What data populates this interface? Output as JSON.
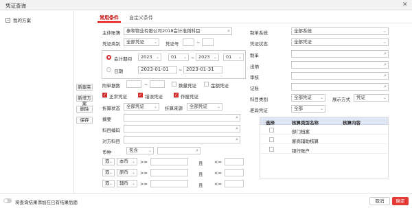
{
  "window": {
    "title": "凭证查询"
  },
  "tree": {
    "root": "我的方案"
  },
  "side_buttons": [
    "新建夹",
    "新增方案",
    "删除",
    "保存"
  ],
  "tabs": [
    {
      "label": "常用条件"
    },
    {
      "label": "自定义条件"
    }
  ],
  "form": {
    "main_book_label": "主体账簿",
    "main_book_value": "泰和物业有限公司2018会计准则科目",
    "voucher_type_label": "凭证类别",
    "voucher_type_value": "全部凭证",
    "voucher_no_label": "凭证号",
    "tilde": "~",
    "period_label": "会计期间",
    "date_label": "日期",
    "period_from_year": "2023",
    "period_from_month": "01",
    "period_to_year": "2023",
    "period_to_month": "01",
    "date_from": "2023-01-01",
    "date_to": "2023-01-31",
    "attach_label": "附单据数",
    "qty_label": "数量凭证",
    "amount_label": "金额凭证",
    "normal_label": "正常凭证",
    "error_label": "错误凭证",
    "void_label": "作废凭证",
    "fold_label": "折算状态",
    "fold_value": "全部凭证",
    "fold_source_label": "折算来源",
    "fold_source_value": "全部凭证",
    "abstract_label": "摘要",
    "subject_code_label": "科目编码",
    "counter_subject_label": "对方科目",
    "currency_label": "币种",
    "currency_value": "包含",
    "amount_rows": [
      {
        "dir": "双",
        "type": "本币",
        "ge": ">=",
        "and": "且",
        "le": "<="
      },
      {
        "dir": "双",
        "type": "原币",
        "ge": ">=",
        "and": "且",
        "le": "<="
      },
      {
        "dir": "双",
        "type": "辅币",
        "ge": ">=",
        "and": "且",
        "le": "<="
      }
    ]
  },
  "right_form": {
    "system_label": "制单系统",
    "system_value": "全部系统",
    "status_label": "凭证状态",
    "status_value": "全部凭证",
    "maker_label": "制单",
    "cashier_label": "出纳",
    "auditor_label": "审核",
    "bookkeeper_label": "记账",
    "subject_type_label": "科目类别",
    "subject_type_value": "全部凭证",
    "display_label": "展示方式",
    "display_value": "凭证",
    "diff_label": "差异凭证",
    "diff_value": "全部"
  },
  "table": {
    "headers": [
      "选择",
      "核算类型名称",
      "核算内容"
    ],
    "rows": [
      {
        "name": "部门档案"
      },
      {
        "name": "客商辅助核算"
      },
      {
        "name": "银行账户"
      }
    ]
  },
  "footer": {
    "toggle_label": "将查询结果添加在已有结果后面",
    "cancel": "取消",
    "ok": "确定"
  },
  "colors": {
    "accent": "#e53935",
    "table_header": "#dfe6f3"
  },
  "icons": [
    "close-icon",
    "search-icon",
    "chevron-down-icon",
    "minus-icon",
    "check-icon"
  ]
}
